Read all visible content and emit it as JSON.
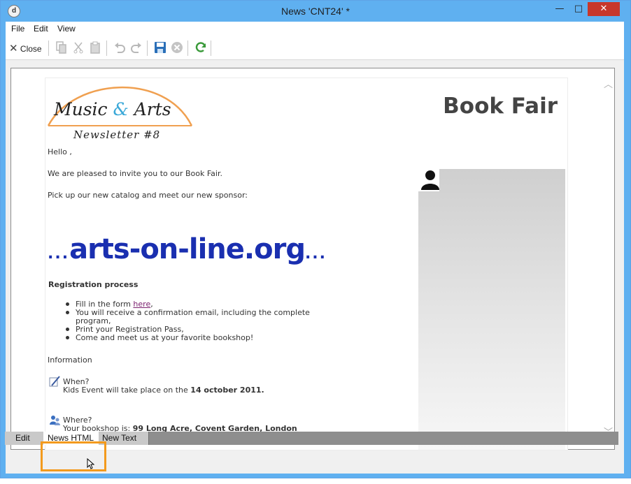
{
  "window": {
    "title": "News 'CNT24' *",
    "app_icon_glyph": "d",
    "min_glyph": "—",
    "max_glyph": "□",
    "close_glyph": "✕"
  },
  "menubar": {
    "file": "File",
    "edit": "Edit",
    "view": "View"
  },
  "toolbar": {
    "close_label": "Close",
    "icons": [
      "close-icon",
      "copy-icon",
      "cut-icon",
      "paste-icon",
      "undo-icon",
      "redo-icon",
      "save-icon",
      "cancel-icon",
      "refresh-icon"
    ]
  },
  "newsletter": {
    "logo_music": "Music",
    "logo_amp": "&",
    "logo_arts": "Arts",
    "logo_subtitle": "Newsletter #8",
    "heading": "Book Fair",
    "greeting": "Hello ,",
    "invite": "We are pleased to invite you to our  Book Fair.",
    "pickup": "Pick up our new catalog and meet our new sponsor:",
    "sponsor_dots_left": "...",
    "sponsor": "arts-on-line.org",
    "sponsor_dots_right": "...",
    "registration_title": "Registration process",
    "steps": {
      "s1_prefix": "Fill in the form ",
      "s1_link": "here",
      "s1_suffix": ",",
      "s2": "You will receive a confirmation email, including the complete program,",
      "s3": "Print your Registration Pass,",
      "s4": "Come and meet us at your favorite bookshop!"
    },
    "information": "Information",
    "when_label": "When?",
    "when_text": "Kids Event will take place on the ",
    "when_date": "14 october 2011.",
    "where_label": "Where?",
    "where_text": "Your bookshop is: ",
    "where_address": "99 Long Acre, Covent Garden, London"
  },
  "tabs": {
    "edit": "Edit",
    "news_html": "News HTML",
    "new_text": "New Text",
    "selected": "News HTML"
  },
  "colors": {
    "titlebar": "#5fb0f0",
    "close_button": "#c7372b",
    "highlight": "#f39a1d",
    "sponsor": "#1a2fb0",
    "logo_arc": "#f0a050",
    "logo_amp": "#3aa8d8"
  }
}
